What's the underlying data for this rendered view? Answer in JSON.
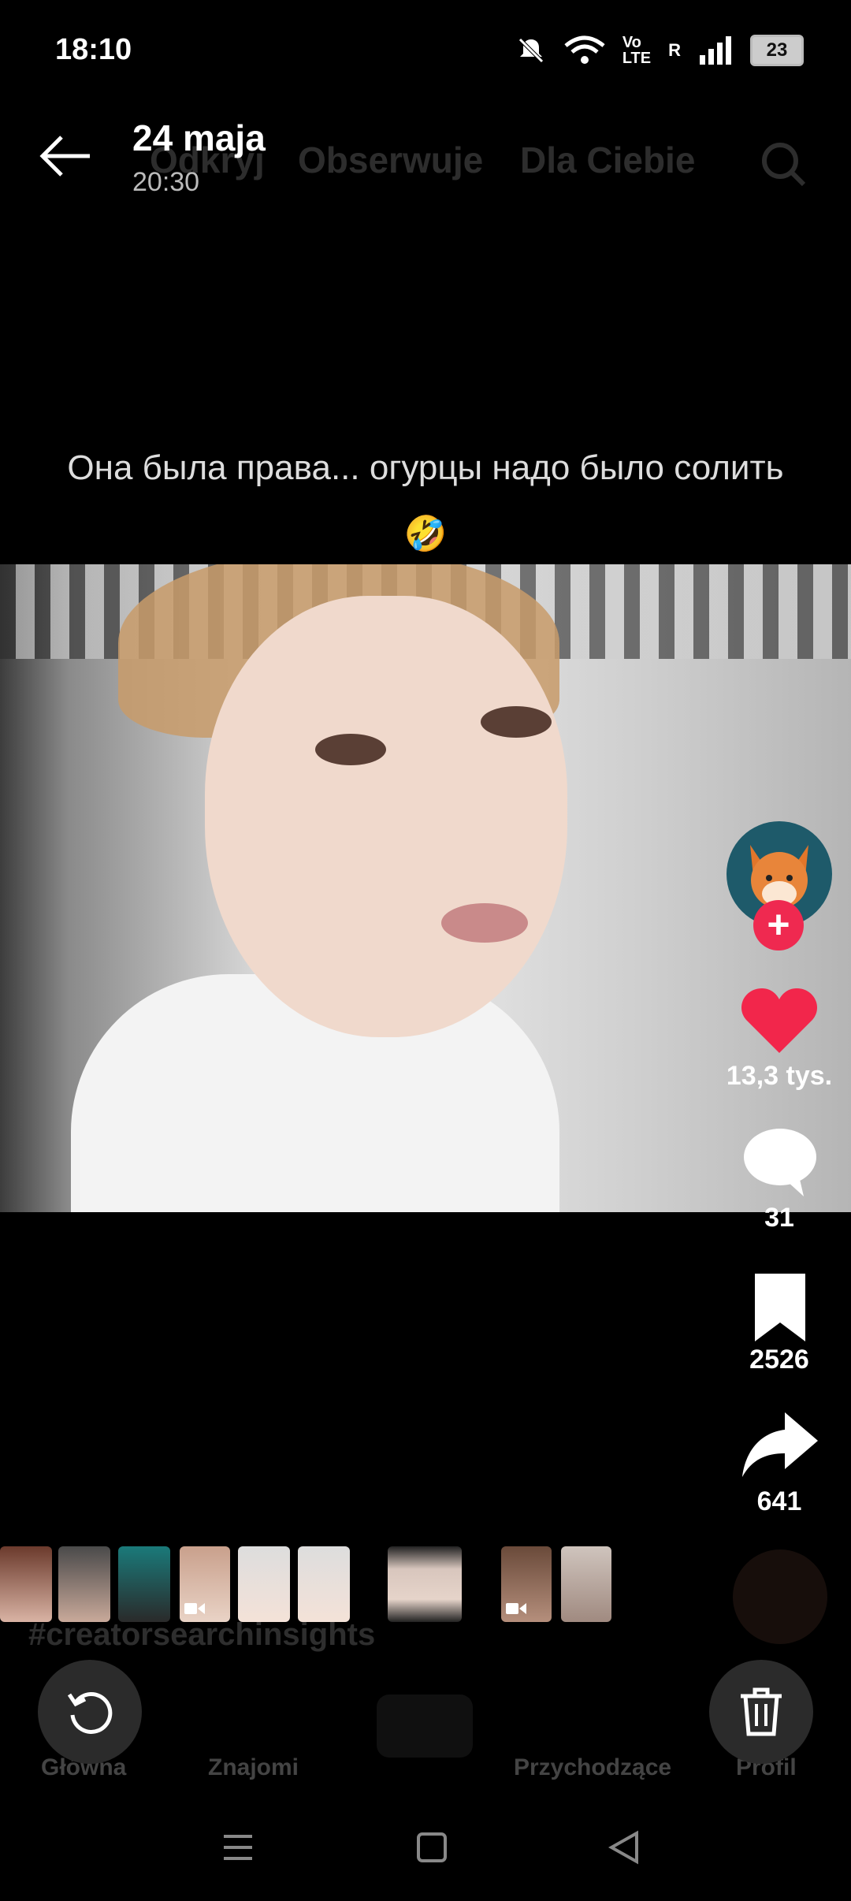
{
  "status_bar": {
    "time": "18:10",
    "network_label": "Vo\nLTE",
    "roaming": "R",
    "battery": "23",
    "icons": [
      "mute-icon",
      "wifi-icon",
      "signal-icon",
      "battery-icon"
    ]
  },
  "background_nav": {
    "tabs": [
      "Odkryj",
      "Obserwuje",
      "Dla Ciebie"
    ]
  },
  "header": {
    "date": "24 maja",
    "time": "20:30"
  },
  "video": {
    "caption": "Она была права... огурцы надо было солить 🤣"
  },
  "actions": {
    "likes": "13,3 tys.",
    "comments": "31",
    "saves": "2526",
    "shares": "641",
    "colors": {
      "like": "#f2264b",
      "follow": "#ef2950"
    }
  },
  "background_hashtag": "#creatorsearchinsights",
  "background_bottom_nav": [
    "Główna",
    "Znajomi",
    "Przychodzące",
    "Profil"
  ]
}
